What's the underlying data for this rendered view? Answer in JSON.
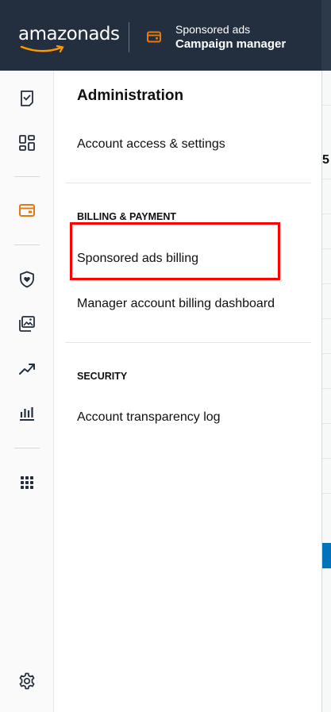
{
  "header": {
    "logo_text": "amazonads",
    "product_line1": "Sponsored ads",
    "product_line2": "Campaign manager"
  },
  "rail": {
    "icons": [
      "tasks-icon",
      "dashboard-icon",
      "billing-wallet-icon",
      "shield-heart-icon",
      "creative-gallery-icon",
      "trend-chart-icon",
      "bar-chart-icon",
      "apps-grid-icon",
      "settings-gear-icon"
    ],
    "active_color": "#e47911"
  },
  "panel": {
    "title": "Administration",
    "account_access": "Account access & settings",
    "billing_section": "BILLING & PAYMENT",
    "sponsored_billing": "Sponsored ads billing",
    "manager_billing": "Manager account billing dashboard",
    "security_section": "SECURITY",
    "transparency_log": "Account transparency log"
  },
  "background": {
    "partial_value": "5"
  },
  "colors": {
    "topbar": "#232f3e",
    "highlight": "#ff0000",
    "accent": "#e47911"
  }
}
